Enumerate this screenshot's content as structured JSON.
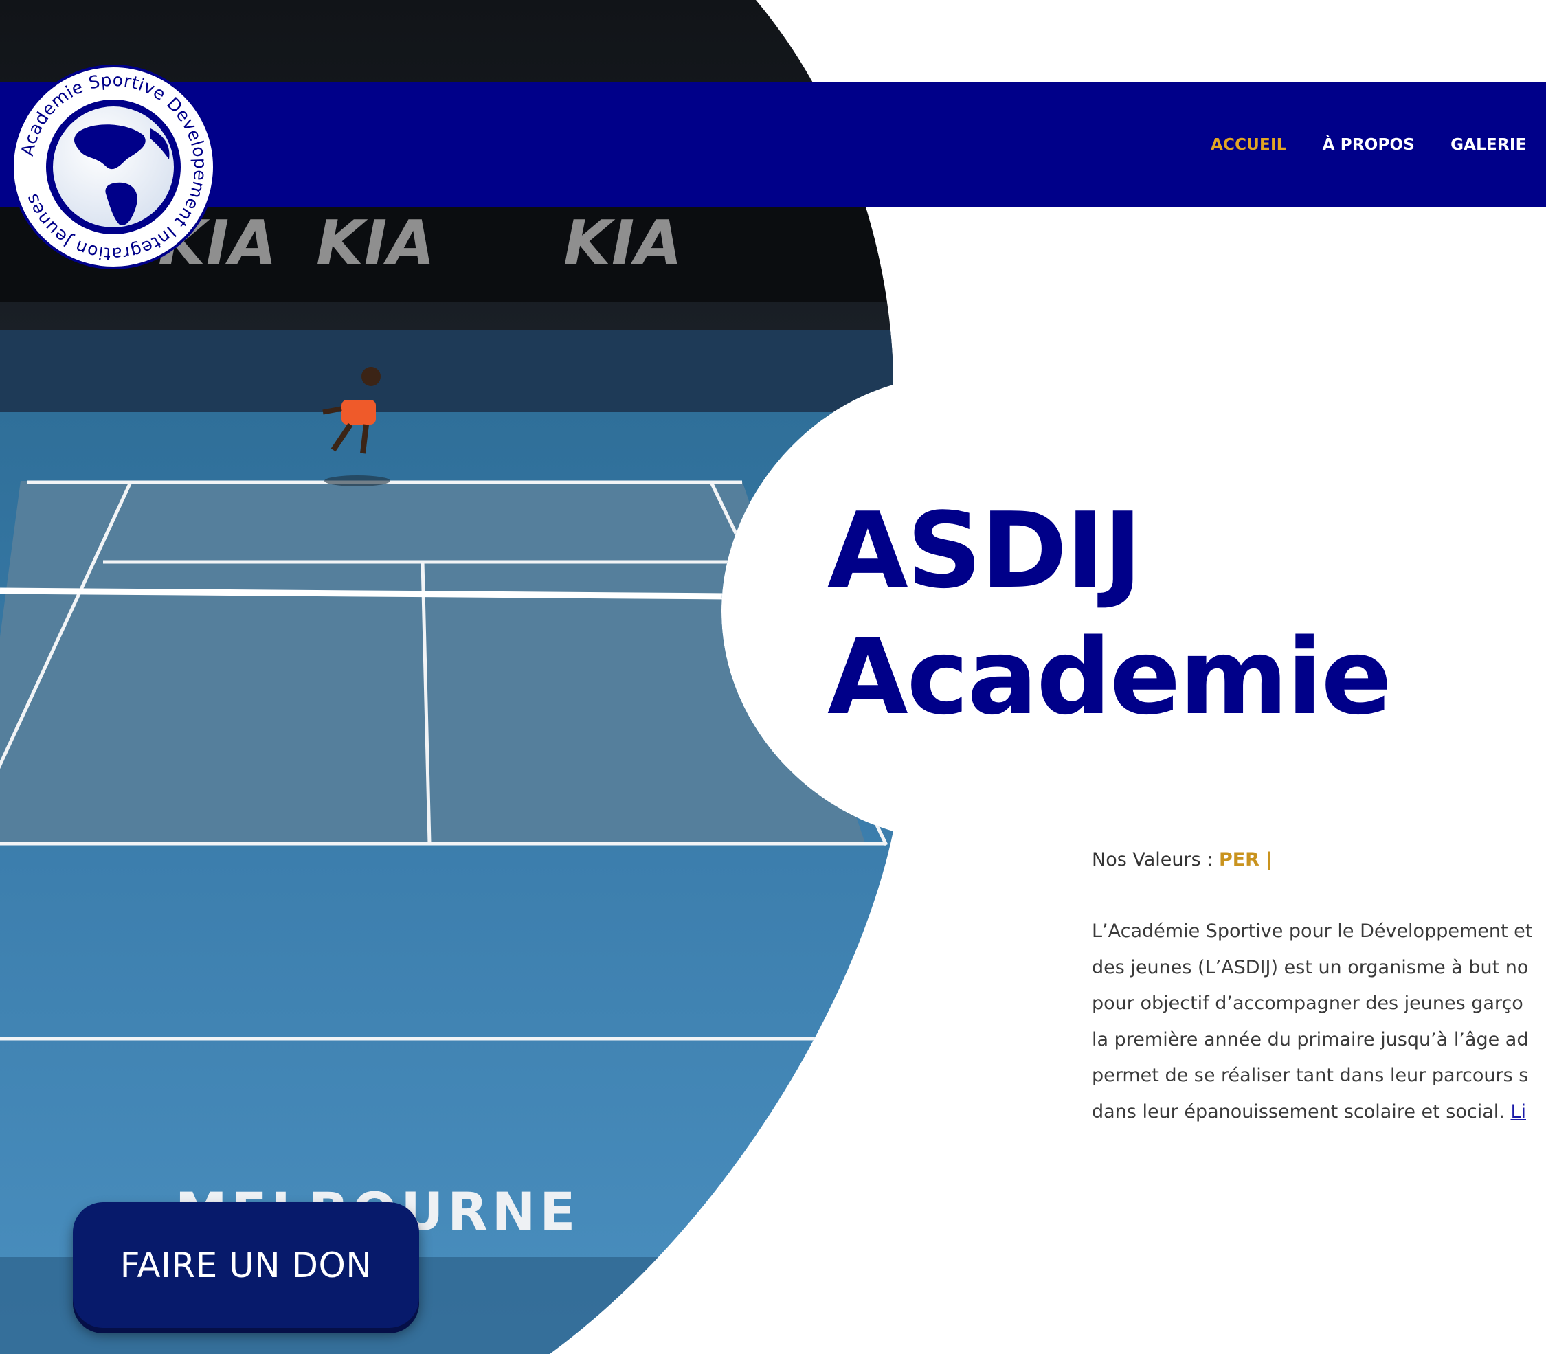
{
  "logo": {
    "ring_text": "Academie Sportive Developement Integration Jeunes"
  },
  "nav": {
    "items": [
      {
        "label": "ACCUEIL",
        "active": true
      },
      {
        "label": "À PROPOS",
        "active": false
      },
      {
        "label": "GALERIE",
        "active": false
      }
    ]
  },
  "hero": {
    "title_line1": "ASDIJ",
    "title_line2": "Academie"
  },
  "values": {
    "label": "Nos Valeurs : ",
    "rotating_text": "PER |"
  },
  "intro": {
    "lines": [
      "L’Académie Sportive pour le Développement et",
      "des jeunes (L’ASDIJ) est un organisme à but no",
      "pour objectif d’accompagner des jeunes garço",
      "la première année du primaire jusqu’à l’âge ad",
      "permet de se réaliser tant dans leur parcours s",
      "dans leur épanouissement scolaire et social. "
    ],
    "link_text": "Li"
  },
  "video": {
    "sponsor_text": "KIA",
    "court_text": "MELBOURNE"
  },
  "donate": {
    "label": "FAIRE UN DON"
  },
  "colors": {
    "brand_navy": "#000089",
    "accent_gold": "#e2a623",
    "button_navy": "#071a6b",
    "court_blue": "#4a86b8"
  }
}
